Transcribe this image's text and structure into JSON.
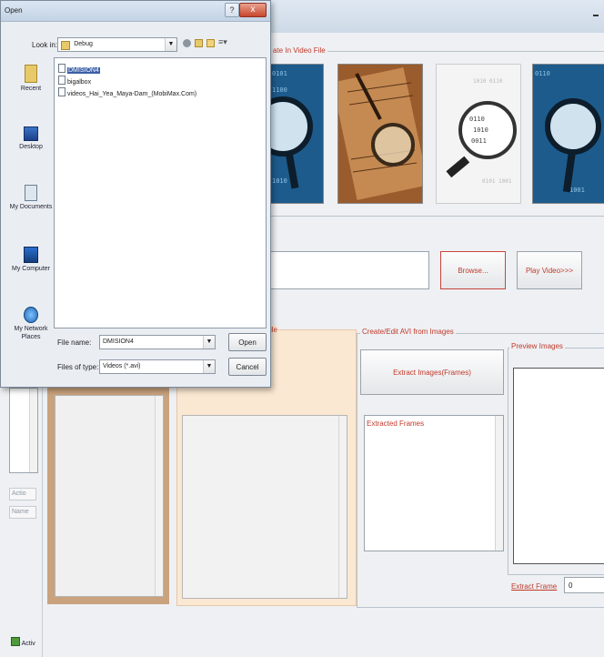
{
  "app": {
    "video_group_title": "ate In Video File",
    "browse_label": "Browse...",
    "play_label": "Play Video>>>",
    "side_group_title": "ile",
    "create_group_title": "Create/Edit AVI from Images",
    "extract_button_label": "Extract Images(Frames)",
    "extracted_frames_label": "Extracted Frames",
    "preview_title": "Preview Images",
    "extract_frame_label": "Extract Frame",
    "extract_frame_value": "0",
    "left_action_label": "Actio",
    "left_name_label": "Name",
    "taskbar_label": "Activ"
  },
  "dialog": {
    "title": "Open",
    "help_glyph": "?",
    "close_glyph": "x",
    "look_in_label": "Look in:",
    "look_in_value": "Debug",
    "places": [
      {
        "label": "Recent",
        "icon": "recent-icon"
      },
      {
        "label": "Desktop",
        "icon": "desktop-icon"
      },
      {
        "label": "My Documents",
        "icon": "my-documents-icon"
      },
      {
        "label": "My Computer",
        "icon": "my-computer-icon"
      },
      {
        "label": "My Network Places",
        "icon": "my-network-places-icon"
      }
    ],
    "files": [
      {
        "name": "DMISION4",
        "selected": true
      },
      {
        "name": "bigalbox",
        "selected": false
      },
      {
        "name": "videos_Hai_Yea_Maya-Dam_(MobiMax.Com)",
        "selected": false
      }
    ],
    "file_name_label": "File name:",
    "file_name_value": "DMISION4",
    "files_of_type_label": "Files of type:",
    "files_of_type_value": "Videos (*.avi)",
    "open_label": "Open",
    "cancel_label": "Cancel"
  }
}
